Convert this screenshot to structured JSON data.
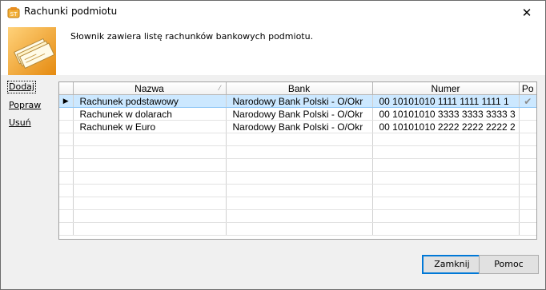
{
  "window": {
    "title": "Rachunki podmiotu",
    "close_label": "✕"
  },
  "header": {
    "description": "Słownik zawiera listę rachunków bankowych podmiotu."
  },
  "side_links": [
    "Dodaj",
    "Popraw",
    "Usuń"
  ],
  "grid": {
    "columns": [
      "Nazwa",
      "Bank",
      "Numer",
      "Po"
    ],
    "rows": [
      {
        "name": "Rachunek podstawowy",
        "bank": "Narodowy Bank Polski  - O/Okr",
        "number": "00 10101010 1111 1111 1111 1",
        "flag": "✔",
        "selected": true
      },
      {
        "name": "Rachunek w dolarach",
        "bank": "Narodowy Bank Polski  - O/Okr",
        "number": "00 10101010 3333 3333 3333 3",
        "flag": "",
        "selected": false
      },
      {
        "name": "Rachunek w Euro",
        "bank": "Narodowy Bank Polski  - O/Okr",
        "number": "00 10101010 2222 2222 2222 2",
        "flag": "",
        "selected": false
      }
    ],
    "current_row_marker": "▶"
  },
  "buttons": {
    "close": "Zamknij",
    "help": "Pomoc"
  },
  "colors": {
    "selected_row": "#cce8ff",
    "accent": "#0078d7"
  },
  "icons": {
    "app": "app-icon",
    "logo": "bank-accounts-icon",
    "close": "close-icon",
    "check": "checkmark-icon"
  }
}
